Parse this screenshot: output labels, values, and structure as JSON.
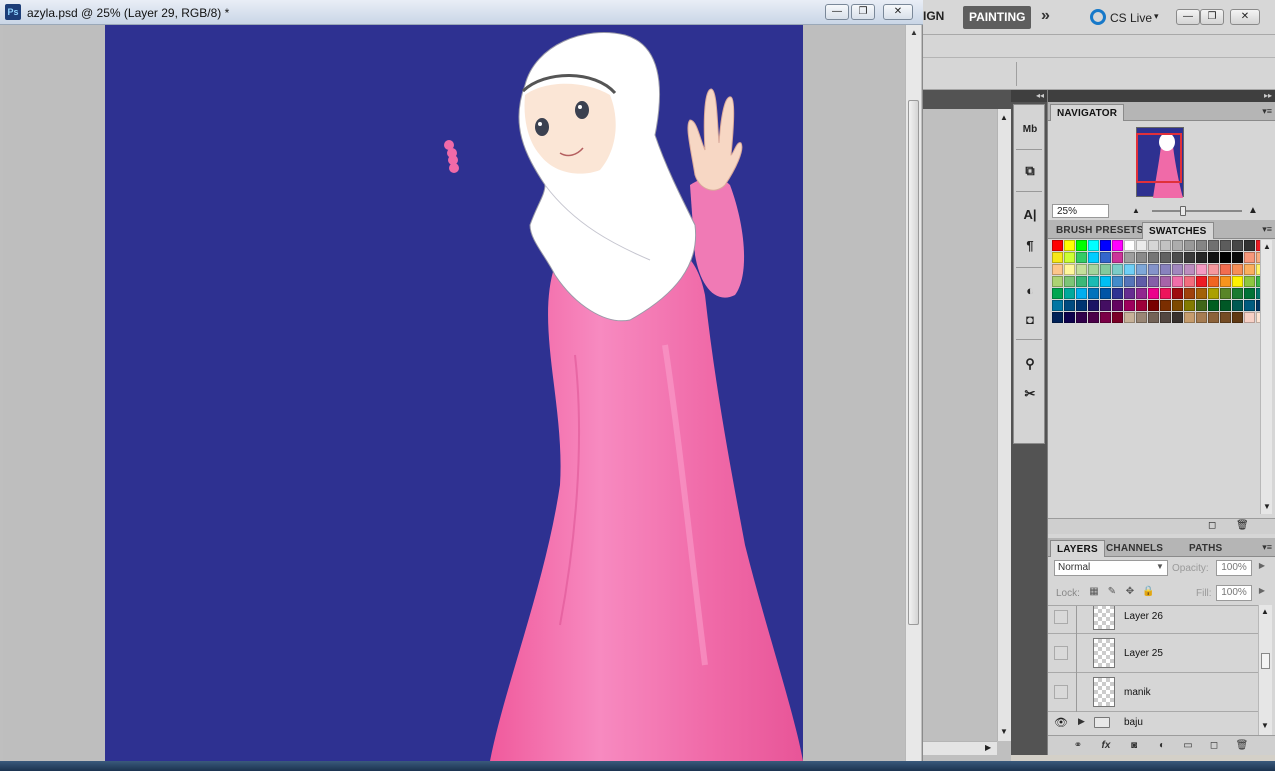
{
  "document": {
    "title": "azyla.psd @ 25% (Layer 29, RGB/8) *",
    "app_icon_text": "Ps",
    "btn_minimize": "—",
    "btn_restore": "❐",
    "btn_close": "✕"
  },
  "app_bar": {
    "workspace_design": "IGN",
    "workspace_painting": "PAINTING",
    "more": "»",
    "cs_live": "CS Live",
    "cs_live_arrow": "▾",
    "btn_minimize": "—",
    "btn_restore": "❐",
    "btn_close": "✕"
  },
  "dock": {
    "collapse_arrows": "◂◂",
    "icons": [
      "Mb",
      "⧉",
      "A|",
      "¶",
      "◐",
      "◘",
      "⚲",
      "✂"
    ]
  },
  "panels": {
    "collapse_arrows": "▸▸",
    "navigator": {
      "tab": "NAVIGATOR",
      "zoom": "25%"
    },
    "swatches_group": {
      "tabs": [
        "BRUSH PRESETS",
        "SWATCHES"
      ],
      "active": "SWATCHES",
      "rows": [
        [
          "#ff0000",
          "#ffff00",
          "#00ff00",
          "#00ffff",
          "#0000ff",
          "#ff00ff",
          "#ffffff",
          "#ebebeb",
          "#d6d6d6",
          "#c2c2c2",
          "#adadad",
          "#999999",
          "#858585",
          "#707070",
          "#5c5c5c",
          "#474747",
          "#333333",
          "#ed1c24"
        ],
        [
          "#f7e817",
          "#ccff33",
          "#33cc66",
          "#00ccff",
          "#3366cc",
          "#cc3399",
          "#9e9e9e",
          "#8a8a8a",
          "#767676",
          "#626262",
          "#4e4e4e",
          "#3a3a3a",
          "#262626",
          "#121212",
          "#000000",
          "#0a0a0a",
          "#f7977a",
          "#f9ad81"
        ],
        [
          "#fdc68a",
          "#fff79a",
          "#c4df9b",
          "#a3d39c",
          "#82ca9d",
          "#7bcdc8",
          "#6ecff6",
          "#7ea7d8",
          "#8493ca",
          "#8882be",
          "#a187be",
          "#bc8dbf",
          "#f49ac2",
          "#f6989d",
          "#f26c4f",
          "#f68e56",
          "#fbaf5d",
          "#fff568"
        ],
        [
          "#acd372",
          "#7cc576",
          "#3bb878",
          "#1abbb4",
          "#00bff3",
          "#438cca",
          "#5574b9",
          "#605ca8",
          "#855fa8",
          "#a763a8",
          "#f06ea9",
          "#f26d7d",
          "#ed1c24",
          "#f26522",
          "#f7941d",
          "#fff200",
          "#8dc63f",
          "#39b54a"
        ],
        [
          "#00a651",
          "#00a99d",
          "#00aeef",
          "#0072bc",
          "#0054a6",
          "#2e3192",
          "#662d91",
          "#92278f",
          "#ec008c",
          "#ed145b",
          "#9e0b0f",
          "#a0410d",
          "#a36209",
          "#aba000",
          "#598527",
          "#197b30",
          "#007236",
          "#00746b"
        ],
        [
          "#0076a3",
          "#004b80",
          "#003471",
          "#1b1464",
          "#440e62",
          "#630460",
          "#9e005d",
          "#9e0039",
          "#790000",
          "#7b2e00",
          "#7d4900",
          "#827b00",
          "#406618",
          "#005e20",
          "#005826",
          "#005952",
          "#005b7f",
          "#003663"
        ],
        [
          "#002157",
          "#0d004c",
          "#32004b",
          "#4b0049",
          "#7b0046",
          "#7a0026",
          "#c7b299",
          "#998675",
          "#736357",
          "#534741",
          "#37302d",
          "#c69c6d",
          "#a67c52",
          "#8c6239",
          "#754c24",
          "#603913",
          "#f7d1c6",
          "#fde5d4"
        ]
      ]
    },
    "layers_group": {
      "tabs": [
        "LAYERS",
        "CHANNELS",
        "PATHS"
      ],
      "active": "LAYERS",
      "blend_mode": "Normal",
      "opacity_label": "Opacity:",
      "opacity_value": "100%",
      "lock_label": "Lock:",
      "fill_label": "Fill:",
      "fill_value": "100%",
      "layers": [
        {
          "name": "Layer 26",
          "visible": false,
          "type": "layer"
        },
        {
          "name": "Layer 25",
          "visible": false,
          "type": "layer"
        },
        {
          "name": "manik",
          "visible": false,
          "type": "layer"
        },
        {
          "name": "baju",
          "visible": true,
          "type": "group"
        }
      ]
    }
  }
}
